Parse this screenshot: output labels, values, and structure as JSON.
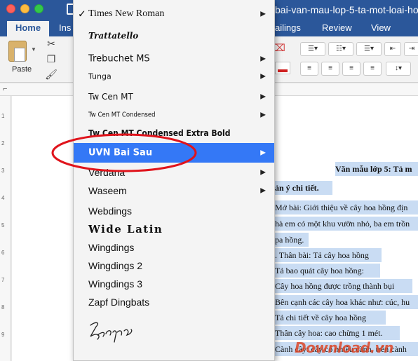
{
  "window": {
    "title": "bai-van-mau-lop-5-ta-mot-loai-ho",
    "tabs": [
      "Home",
      "Ins",
      "ailings",
      "Review",
      "View"
    ]
  },
  "ribbon": {
    "paste_label": "Paste"
  },
  "ruler": {
    "vertical_ticks": [
      "1",
      "2",
      "3",
      "4",
      "5",
      "6",
      "7",
      "8",
      "9"
    ]
  },
  "font_menu": {
    "items": [
      {
        "label": "Times New Roman",
        "checked": true,
        "submenu": true
      },
      {
        "label": "Trattatello",
        "submenu": false
      },
      {
        "label": "Trebuchet MS",
        "submenu": true
      },
      {
        "label": "Tunga",
        "submenu": true
      },
      {
        "label": "Tw Cen MT",
        "submenu": true
      },
      {
        "label": "Tw Cen MT Condensed",
        "submenu": true
      },
      {
        "label": "Tw Cen MT Condensed Extra Bold",
        "submenu": false
      },
      {
        "label": "UVN Bai Sau",
        "highlighted": true,
        "submenu": true
      },
      {
        "label": "Verdana",
        "submenu": true
      },
      {
        "label": "Waseem",
        "submenu": true
      },
      {
        "label": "Webdings",
        "submenu": false
      },
      {
        "label": "Wide Latin",
        "submenu": false
      },
      {
        "label": "Wingdings",
        "submenu": false
      },
      {
        "label": "Wingdings 2",
        "submenu": false
      },
      {
        "label": "Wingdings 3",
        "submenu": false
      },
      {
        "label": "Zapf Dingbats",
        "submenu": false
      },
      {
        "label": "Zapfino",
        "submenu": false
      }
    ],
    "checkmark": "✓",
    "submenu_arrow": "▶",
    "annotation_color": "#e0141c",
    "highlight_color": "#3478f6"
  },
  "document": {
    "lines": [
      "Văn mẫu lớp 5: Tả m",
      "ản ý chi tiết.",
      "Mở bài: Giới thiệu về cây hoa hồng địn",
      "hà em có một khu vườn nhỏ, ba em trồn",
      "ра hồng.",
      ". Thân bài: Tả cây hoa hồng",
      "Tả bao quát cây hoa hồng:",
      "Cây hoa hồng được trồng thành bụi",
      "Bên cạnh các cây hoa khác như: cúc, hu",
      "Tả chi tiết về cây hoa hồng",
      "Thân cây hoa: cao chừng 1 mét.",
      "Cành cây: cây có nhiều cành, trên cành"
    ],
    "watermark": "Download.vn"
  },
  "colors": {
    "word_blue": "#2b579a",
    "selection": "#c9dcf3"
  }
}
